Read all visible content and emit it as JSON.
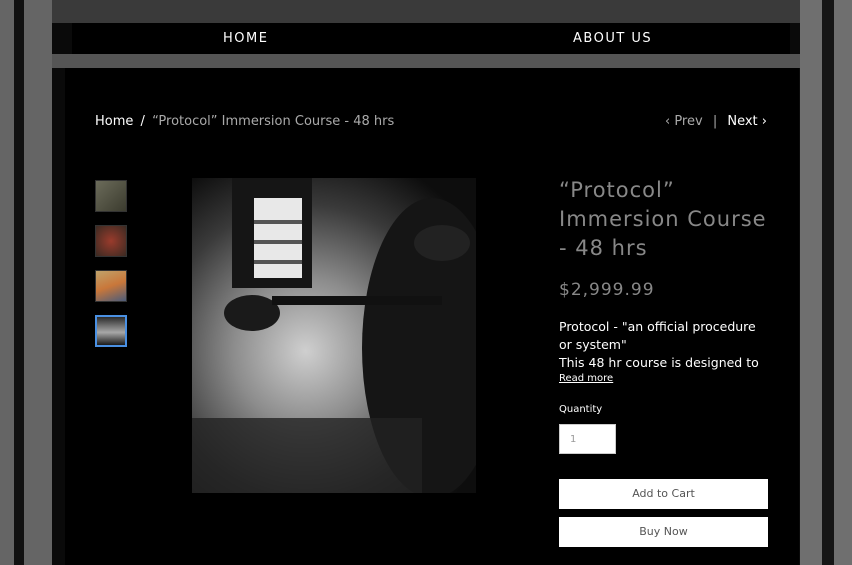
{
  "nav": {
    "home": "HOME",
    "about": "ABOUT US"
  },
  "breadcrumb": {
    "home": "Home",
    "separator": "/",
    "current": "“Protocol” Immersion Course - 48 hrs"
  },
  "pager": {
    "prev": "Prev",
    "next": "Next",
    "divider": "|"
  },
  "product": {
    "title": "“Protocol” Immersion Course - 48 hrs",
    "price": "$2,999.99",
    "description_line1": "Protocol - \"an official procedure or system\"",
    "description_line2": "This 48 hr course is designed to",
    "read_more": "Read more",
    "quantity_label": "Quantity",
    "quantity_value": "1",
    "add_to_cart": "Add to Cart",
    "buy_now": "Buy Now"
  },
  "colors": {
    "accent_selected_thumb": "#4a90e2",
    "title_gray": "#888888"
  },
  "icons": {
    "prev": "chevron-left-icon",
    "next": "chevron-right-icon"
  }
}
